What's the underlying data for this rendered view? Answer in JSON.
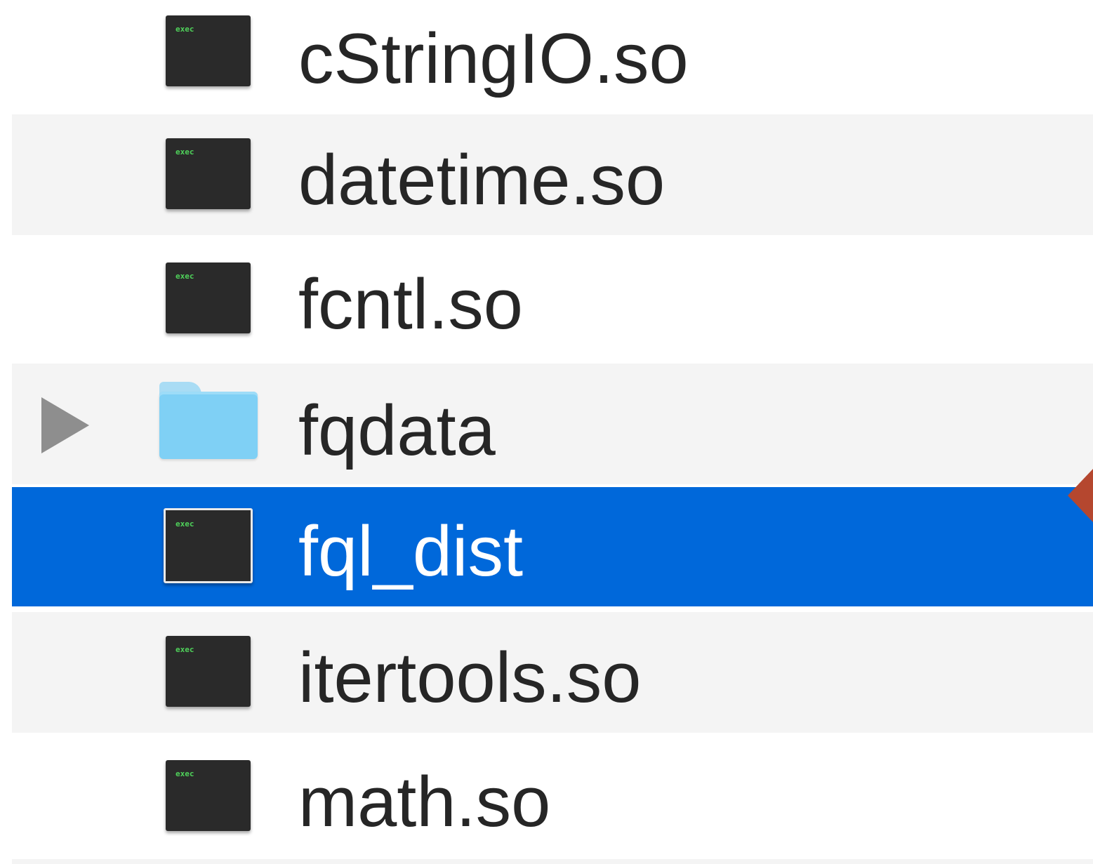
{
  "file_list": {
    "items": [
      {
        "name": "cStringIO.so",
        "kind": "executable",
        "icon_label": "exec",
        "selected": false
      },
      {
        "name": "datetime.so",
        "kind": "executable",
        "icon_label": "exec",
        "selected": false
      },
      {
        "name": "fcntl.so",
        "kind": "executable",
        "icon_label": "exec",
        "selected": false
      },
      {
        "name": "fqdata",
        "kind": "folder",
        "collapsed": true,
        "selected": false
      },
      {
        "name": "fql_dist",
        "kind": "executable",
        "icon_label": "exec",
        "selected": true
      },
      {
        "name": "itertools.so",
        "kind": "executable",
        "icon_label": "exec",
        "selected": false
      },
      {
        "name": "math.so",
        "kind": "executable",
        "icon_label": "exec",
        "selected": false
      }
    ]
  },
  "colors": {
    "selection": "#0068da",
    "alternate_row": "#f4f4f4",
    "folder": "#7fd0f5",
    "annotation_arrow": "#b5472f"
  },
  "icons": {
    "executable": "terminal-exec-icon",
    "folder": "folder-icon",
    "disclosure": "disclosure-triangle-icon",
    "annotation": "arrow-pointer-icon"
  }
}
